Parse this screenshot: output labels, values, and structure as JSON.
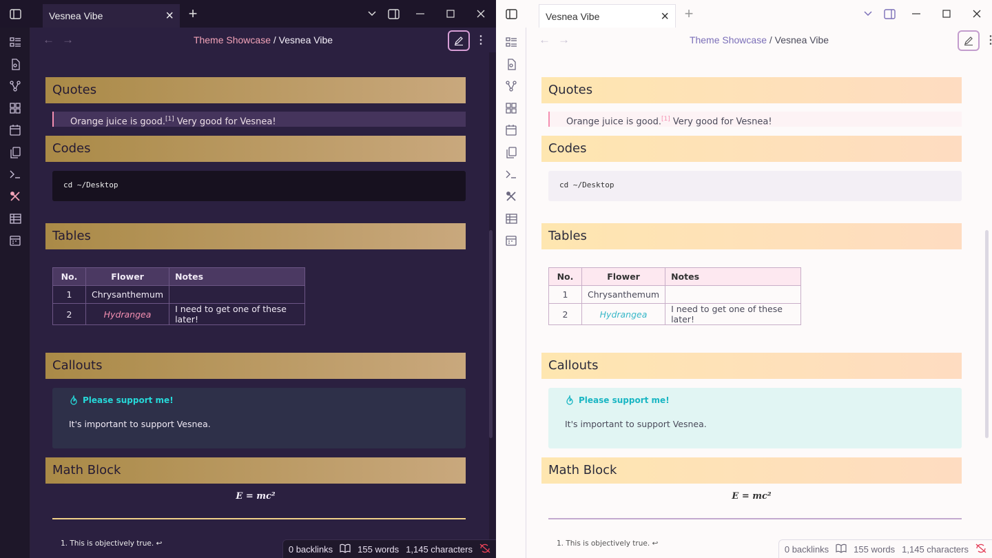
{
  "app": {
    "tab_title": "Vesnea Vibe",
    "close_tab_icon": "×",
    "new_tab_icon": "+"
  },
  "navbar": {
    "breadcrumb_parent": "Theme Showcase",
    "breadcrumb_sep": "/",
    "breadcrumb_current": "Vesnea Vibe"
  },
  "note": {
    "quotes_heading": "Quotes",
    "quote_text": "Orange juice is good.",
    "quote_ref": "[1]",
    "quote_tail": " Very good for Vesnea!",
    "codes_heading": "Codes",
    "code_text": "cd ~/Desktop",
    "tables_heading": "Tables",
    "table": {
      "headers": [
        "No.",
        "Flower",
        "Notes"
      ],
      "rows": [
        [
          "1",
          "Chrysanthemum",
          ""
        ],
        [
          "2",
          "Hydrangea",
          "I need to get one of these later!"
        ]
      ]
    },
    "callouts_heading": "Callouts",
    "callout_title": "Please support me!",
    "callout_body": "It's important to support Vesnea.",
    "math_heading": "Math Block",
    "math_formula": "E = mc²",
    "footnote": "1. This is objectively true. ↩"
  },
  "status": {
    "backlinks": "0 backlinks",
    "words": "155 words",
    "characters": "1,145 characters"
  },
  "colors": {
    "dark_bg": "#241a33",
    "dark_accent": "#f48fb1",
    "light_bg": "#fdfafa",
    "callout_teal": "#19b6c3"
  }
}
